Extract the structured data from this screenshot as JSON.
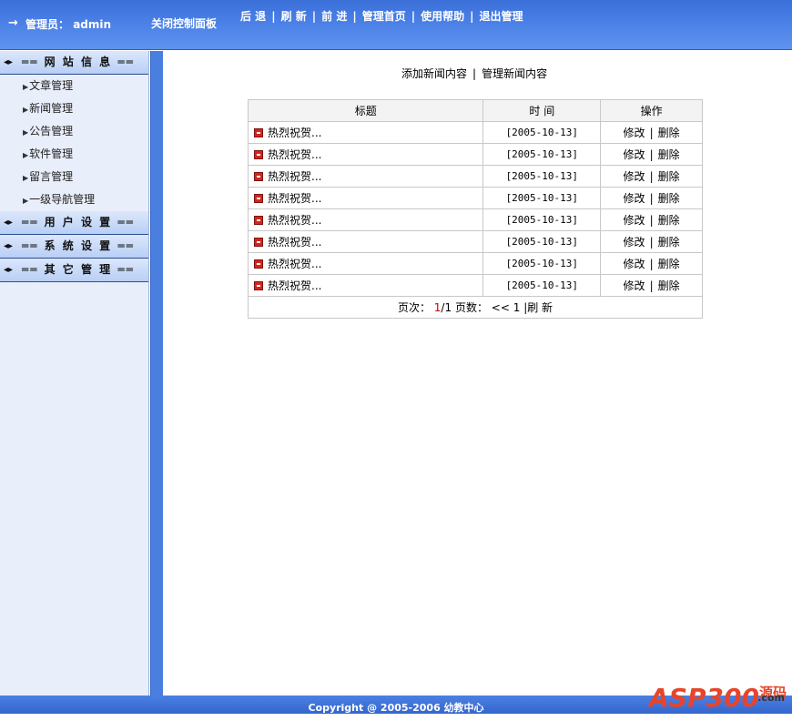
{
  "topbar": {
    "arrow": "→",
    "admin_label": "管理员：",
    "admin_name": "admin",
    "close_panel": "关闭控制面板",
    "nav": [
      "后 退",
      "刷 新",
      "前 进",
      "管理首页",
      "使用帮助",
      "退出管理"
    ]
  },
  "sidebar": {
    "sections": [
      {
        "icon": "▸",
        "label": "══ 网 站 信 息 ══",
        "items": [
          "文章管理",
          "新闻管理",
          "公告管理",
          "软件管理",
          "留言管理",
          "一级导航管理"
        ]
      },
      {
        "icon": "▸",
        "label": "══ 用 户 设 置 ══",
        "items": []
      },
      {
        "icon": "▸",
        "label": "══ 系 统 设 置 ══",
        "items": []
      },
      {
        "icon": "▸",
        "label": "══ 其 它 管 理 ══",
        "items": []
      }
    ]
  },
  "main": {
    "add_link": "添加新闻内容",
    "manage_link": "管理新闻内容",
    "table": {
      "headers": [
        "标题",
        "时 间",
        "操作"
      ],
      "rows": [
        {
          "title": "热烈祝贺...",
          "time": "[2005-10-13]",
          "edit": "修改",
          "delete": "删除"
        },
        {
          "title": "热烈祝贺...",
          "time": "[2005-10-13]",
          "edit": "修改",
          "delete": "删除"
        },
        {
          "title": "热烈祝贺...",
          "time": "[2005-10-13]",
          "edit": "修改",
          "delete": "删除"
        },
        {
          "title": "热烈祝贺...",
          "time": "[2005-10-13]",
          "edit": "修改",
          "delete": "删除"
        },
        {
          "title": "热烈祝贺...",
          "time": "[2005-10-13]",
          "edit": "修改",
          "delete": "删除"
        },
        {
          "title": "热烈祝贺...",
          "time": "[2005-10-13]",
          "edit": "修改",
          "delete": "删除"
        },
        {
          "title": "热烈祝贺...",
          "time": "[2005-10-13]",
          "edit": "修改",
          "delete": "删除"
        },
        {
          "title": "热烈祝贺...",
          "time": "[2005-10-13]",
          "edit": "修改",
          "delete": "删除"
        }
      ]
    },
    "pager": {
      "page_label": "页次：",
      "current": "1",
      "total": "/1",
      "pages_label": "页数：",
      "prev": "<<",
      "page_link": "1",
      "refresh": "|刷 新"
    }
  },
  "footer": {
    "copyright": "Copyright @ 2005-2006 幼教中心",
    "logo_main": "ASP300",
    "logo_cn": "源码",
    "logo_com": ".com"
  },
  "colors": {
    "topbar": "#4a80e6",
    "band": "#4a7fe0",
    "sidebar_bg": "#e9eefb",
    "footer": "#3f73d8"
  },
  "icons": {
    "title_row_icon": "red-square-icon",
    "section_icon": "expand-arrow-icon",
    "item_icon": "small-triangle-icon"
  }
}
